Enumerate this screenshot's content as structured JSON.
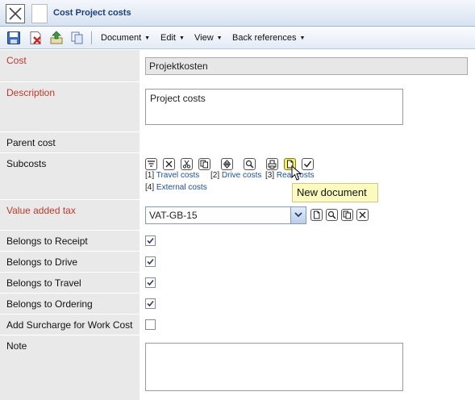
{
  "window": {
    "title": "Cost Project costs"
  },
  "toolbar": {
    "icons": [
      "save-icon",
      "delete-icon",
      "upload-icon",
      "copy-icon"
    ],
    "menus": [
      {
        "label": "Document"
      },
      {
        "label": "Edit"
      },
      {
        "label": "View"
      },
      {
        "label": "Back references"
      }
    ]
  },
  "form": {
    "cost": {
      "label": "Cost",
      "value": "Projektkosten"
    },
    "description": {
      "label": "Description",
      "value": "Project costs"
    },
    "parent_cost": {
      "label": "Parent cost"
    },
    "subcosts": {
      "label": "Subcosts",
      "items": [
        {
          "prefix": "[1]",
          "label": "Travel costs"
        },
        {
          "prefix": "[2]",
          "label": "Drive costs"
        },
        {
          "prefix": "[3]",
          "label": "Real costs"
        },
        {
          "prefix": "[4]",
          "label": "External costs"
        }
      ],
      "tooltip": "New document"
    },
    "vat": {
      "label": "Value added tax",
      "value": "VAT-GB-15"
    },
    "belongs_receipt": {
      "label": "Belongs to Receipt",
      "checked": true
    },
    "belongs_drive": {
      "label": "Belongs to Drive",
      "checked": true
    },
    "belongs_travel": {
      "label": "Belongs to Travel",
      "checked": true
    },
    "belongs_ordering": {
      "label": "Belongs to Ordering",
      "checked": true
    },
    "add_surcharge": {
      "label": "Add Surcharge for Work Cost",
      "checked": false
    },
    "note": {
      "label": "Note",
      "value": ""
    }
  },
  "colors": {
    "required_label": "#c0392b",
    "link": "#1d4fa0",
    "title": "#1c3f7a",
    "tooltip_bg": "#fbfbbf"
  }
}
